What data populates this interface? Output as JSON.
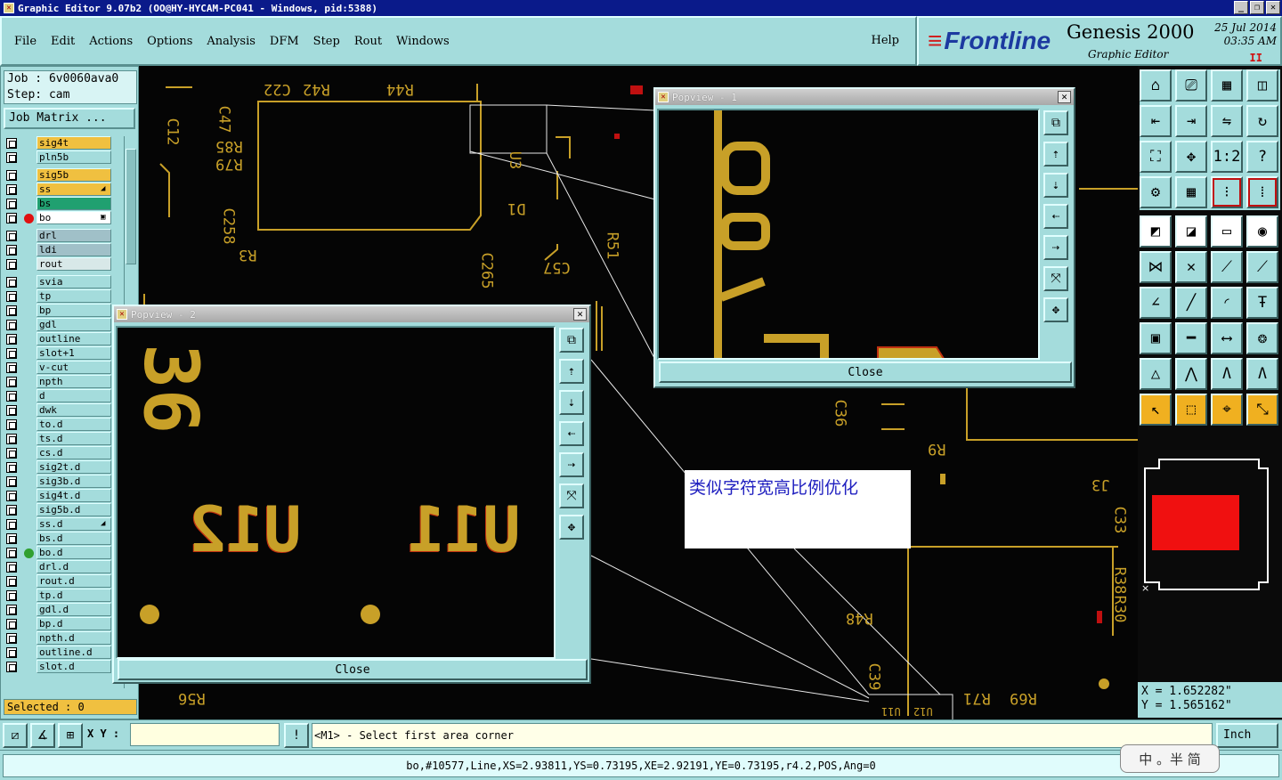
{
  "window": {
    "title": "Graphic Editor 9.07b2 (OO@HY-HYCAM-PC041 - Windows, pid:5388)",
    "controls": [
      "_",
      "❐",
      "✕"
    ]
  },
  "menu": {
    "items": [
      "File",
      "Edit",
      "Actions",
      "Options",
      "Analysis",
      "DFM",
      "Step",
      "Rout",
      "Windows"
    ],
    "help": "Help"
  },
  "brand": {
    "logo": "Frontline",
    "product": "Genesis 2000",
    "subtitle": "Graphic Editor",
    "date": "25 Jul 2014",
    "time": "03:35 AM",
    "pause": "II"
  },
  "left": {
    "job": "Job : 6v0060ava0",
    "step": "Step: cam",
    "job_matrix": "Job Matrix ...",
    "selected": "Selected : 0",
    "layers": [
      {
        "name": "sig4t",
        "color": "#f0c040",
        "dot": ""
      },
      {
        "name": "pln5b",
        "color": "#a4dcdc",
        "dot": ""
      },
      {
        "name": "sig5b",
        "color": "#f0c040",
        "dot": ""
      },
      {
        "name": "ss",
        "color": "#f0c040",
        "dot": "",
        "mark": "◢"
      },
      {
        "name": "bs",
        "color": "#20a070",
        "dot": ""
      },
      {
        "name": "bo",
        "color": "#ffffff",
        "dot": "#e01010",
        "mark": "▣"
      },
      {
        "name": "drl",
        "color": "#a0c0c8",
        "dot": ""
      },
      {
        "name": "ldi",
        "color": "#a0c0c8",
        "dot": ""
      },
      {
        "name": "rout",
        "color": "#d8e8e8",
        "dot": ""
      },
      {
        "name": "svia",
        "color": "#a4dcdc",
        "dot": ""
      },
      {
        "name": "tp",
        "color": "#a4dcdc",
        "dot": ""
      },
      {
        "name": "bp",
        "color": "#a4dcdc",
        "dot": ""
      },
      {
        "name": "gdl",
        "color": "#a4dcdc",
        "dot": ""
      },
      {
        "name": "outline",
        "color": "#a4dcdc",
        "dot": ""
      },
      {
        "name": "slot+1",
        "color": "#a4dcdc",
        "dot": ""
      },
      {
        "name": "v-cut",
        "color": "#a4dcdc",
        "dot": ""
      },
      {
        "name": "npth",
        "color": "#a4dcdc",
        "dot": ""
      },
      {
        "name": "d",
        "color": "#a4dcdc",
        "dot": ""
      },
      {
        "name": "dwk",
        "color": "#a4dcdc",
        "dot": ""
      },
      {
        "name": "to.d",
        "color": "#a4dcdc",
        "dot": ""
      },
      {
        "name": "ts.d",
        "color": "#a4dcdc",
        "dot": ""
      },
      {
        "name": "cs.d",
        "color": "#a4dcdc",
        "dot": ""
      },
      {
        "name": "sig2t.d",
        "color": "#a4dcdc",
        "dot": ""
      },
      {
        "name": "sig3b.d",
        "color": "#a4dcdc",
        "dot": ""
      },
      {
        "name": "sig4t.d",
        "color": "#a4dcdc",
        "dot": ""
      },
      {
        "name": "sig5b.d",
        "color": "#a4dcdc",
        "dot": ""
      },
      {
        "name": "ss.d",
        "color": "#a4dcdc",
        "dot": "",
        "mark": "◢"
      },
      {
        "name": "bs.d",
        "color": "#a4dcdc",
        "dot": ""
      },
      {
        "name": "bo.d",
        "color": "#a4dcdc",
        "dot": "#30a030"
      },
      {
        "name": "drl.d",
        "color": "#a4dcdc",
        "dot": ""
      },
      {
        "name": "rout.d",
        "color": "#a4dcdc",
        "dot": ""
      },
      {
        "name": "tp.d",
        "color": "#a4dcdc",
        "dot": ""
      },
      {
        "name": "gdl.d",
        "color": "#a4dcdc",
        "dot": ""
      },
      {
        "name": "bp.d",
        "color": "#a4dcdc",
        "dot": ""
      },
      {
        "name": "npth.d",
        "color": "#a4dcdc",
        "dot": ""
      },
      {
        "name": "outline.d",
        "color": "#a4dcdc",
        "dot": ""
      },
      {
        "name": "slot.d",
        "color": "#a4dcdc",
        "dot": ""
      }
    ]
  },
  "canvas": {
    "labels": [
      "C22",
      "R42",
      "R44",
      "C12",
      "C47",
      "R85",
      "R79",
      "C258",
      "R3",
      "U3",
      "D1",
      "C57",
      "R51",
      "C265",
      "C36",
      "R9",
      "J3",
      "R48",
      "C39",
      "R71",
      "R69",
      "R56",
      "C33",
      "R38",
      "R30",
      "U11",
      "U12"
    ],
    "note": "类似字符宽高比例优化"
  },
  "popview1": {
    "title": "Popview - 1",
    "close": "Close"
  },
  "popview2": {
    "title": "Popview - 2",
    "close": "Close",
    "text_u12": "U12",
    "text_u11": "U11",
    "text_top": "36"
  },
  "right": {
    "coord_x": "X = 1.652282\"",
    "coord_y": "Y = 1.565162\""
  },
  "bottom": {
    "xy_label": "X Y :",
    "xy_value": "",
    "prompt": "<M1> - Select first area corner",
    "units": "Inch",
    "status": "bo,#10577,Line,XS=2.93811,YS=0.73195,XE=2.92191,YE=0.73195,r4.2,POS,Ang=0",
    "ime": "中 。半 简"
  },
  "colors": {
    "panel": "#a4dcdc",
    "silk": "#c8a028",
    "accent": "#0a1a8a"
  }
}
